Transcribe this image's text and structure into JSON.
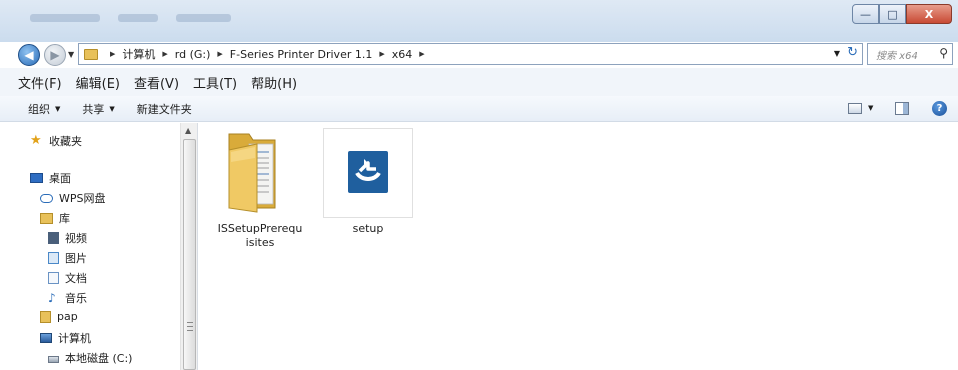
{
  "window": {
    "title_controls": {
      "minimize": "—",
      "maximize": "□",
      "close": "X"
    }
  },
  "address": {
    "breadcrumbs": [
      "计算机",
      "rd (G:)",
      "F-Series Printer Driver 1.1",
      "x64"
    ],
    "search_placeholder": "搜索 x64"
  },
  "menu": [
    "文件(F)",
    "编辑(E)",
    "查看(V)",
    "工具(T)",
    "帮助(H)"
  ],
  "commands": {
    "organize": "组织",
    "share": "共享",
    "new_folder": "新建文件夹"
  },
  "nav": {
    "favorites": "收藏夹",
    "desktop": "桌面",
    "wps": "WPS网盘",
    "libraries": "库",
    "videos": "视频",
    "pictures": "图片",
    "documents": "文档",
    "music": "音乐",
    "pap": "pap",
    "computer": "计算机",
    "local_disk": "本地磁盘 (C:)"
  },
  "files": [
    {
      "name": "ISSetupPrerequisites",
      "line1": "ISSetupPrerequ",
      "line2": "isites",
      "icon": "folder-icon"
    },
    {
      "name": "setup",
      "line1": "setup",
      "line2": "",
      "icon": "installer-icon"
    }
  ],
  "colors": {
    "titlebar": "#cbdcee",
    "accent": "#2a6cb8",
    "folder": "#e8c15a",
    "installer_bg": "#1f5f9e"
  }
}
